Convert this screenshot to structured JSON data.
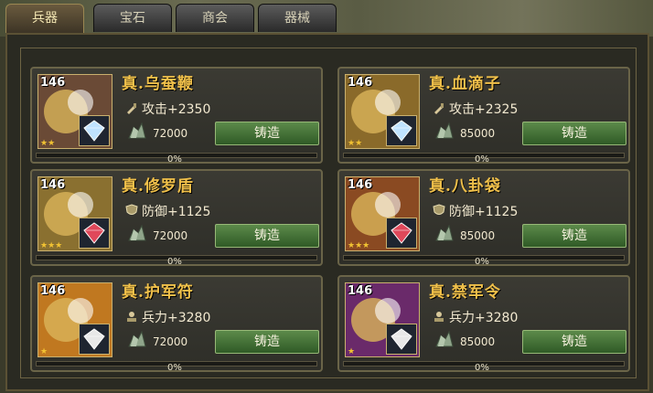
{
  "tabs": [
    {
      "label": "兵器",
      "active": true
    },
    {
      "label": "宝石",
      "active": false
    },
    {
      "label": "商会",
      "active": false
    },
    {
      "label": "器械",
      "active": false
    }
  ],
  "forge_label": "铸造",
  "cards": [
    {
      "level": "146",
      "name": "真.乌蚕鞭",
      "stat": "攻击+2350",
      "stat_icon": "sword-icon",
      "cost": "72000",
      "progress": "0%",
      "progress_value": 0,
      "gem": "diamond",
      "gem_color": "#bfe3ff",
      "stars": "★★",
      "art": "#6a4a36"
    },
    {
      "level": "146",
      "name": "真.血滴子",
      "stat": "攻击+2325",
      "stat_icon": "sword-icon",
      "cost": "85000",
      "progress": "0%",
      "progress_value": 0,
      "gem": "diamond",
      "gem_color": "#bfe3ff",
      "stars": "★★",
      "art": "#8a6a2a"
    },
    {
      "level": "146",
      "name": "真.修罗盾",
      "stat": "防御+1125",
      "stat_icon": "shield-icon",
      "cost": "72000",
      "progress": "0%",
      "progress_value": 0,
      "gem": "ruby",
      "gem_color": "#e0485a",
      "stars": "★★★",
      "art": "#8a7030"
    },
    {
      "level": "146",
      "name": "真.八卦袋",
      "stat": "防御+1125",
      "stat_icon": "shield-icon",
      "cost": "85000",
      "progress": "0%",
      "progress_value": 0,
      "gem": "ruby",
      "gem_color": "#e0485a",
      "stars": "★★★",
      "art": "#8a4a22"
    },
    {
      "level": "146",
      "name": "真.护军符",
      "stat": "兵力+3280",
      "stat_icon": "soldier-icon",
      "cost": "72000",
      "progress": "0%",
      "progress_value": 0,
      "gem": "pearl",
      "gem_color": "#e8e8e8",
      "stars": "★",
      "art": "#c07820"
    },
    {
      "level": "146",
      "name": "真.禁军令",
      "stat": "兵力+3280",
      "stat_icon": "soldier-icon",
      "cost": "85000",
      "progress": "0%",
      "progress_value": 0,
      "gem": "pearl",
      "gem_color": "#e8e8e8",
      "stars": "★",
      "art": "#6a2a6a"
    }
  ]
}
